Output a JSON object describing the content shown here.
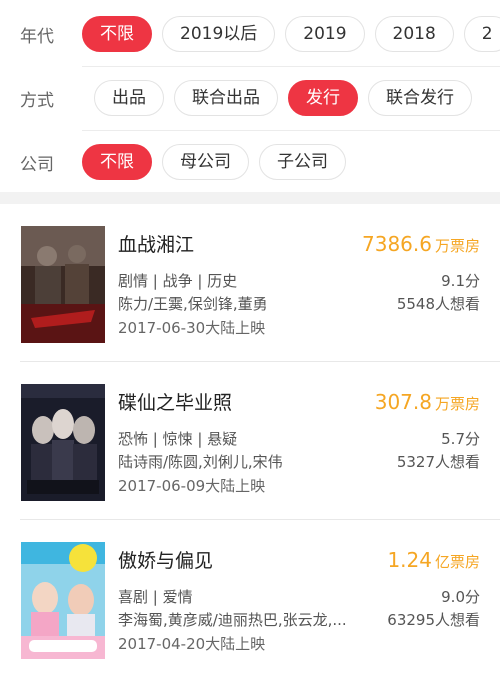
{
  "filters": {
    "era": {
      "label": "年代",
      "options": [
        "不限",
        "2019以后",
        "2019",
        "2018",
        "2"
      ]
    },
    "mode": {
      "label": "方式",
      "options": [
        "出品",
        "联合出品",
        "发行",
        "联合发行"
      ]
    },
    "company": {
      "label": "公司",
      "options": [
        "不限",
        "母公司",
        "子公司"
      ]
    }
  },
  "movies": [
    {
      "title": "血战湘江",
      "box_office": "7386.6",
      "box_unit": "万票房",
      "genres": "剧情 | 战争 | 历史",
      "score": "9.1分",
      "cast": "陈力/王霙,保剑锋,董勇",
      "want": "5548人想看",
      "release": "2017-06-30大陆上映"
    },
    {
      "title": "碟仙之毕业照",
      "box_office": "307.8",
      "box_unit": "万票房",
      "genres": "恐怖 | 惊悚 | 悬疑",
      "score": "5.7分",
      "cast": "陆诗雨/陈圆,刘俐儿,宋伟",
      "want": "5327人想看",
      "release": "2017-06-09大陆上映"
    },
    {
      "title": "傲娇与偏见",
      "box_office": "1.24",
      "box_unit": "亿票房",
      "genres": "喜剧 | 爱情",
      "score": "9.0分",
      "cast": "李海蜀,黄彦威/迪丽热巴,张云龙,...",
      "want": "63295人想看",
      "release": "2017-04-20大陆上映"
    }
  ],
  "colors": {
    "accent": "#ee3543",
    "box_office": "#f5a623"
  }
}
